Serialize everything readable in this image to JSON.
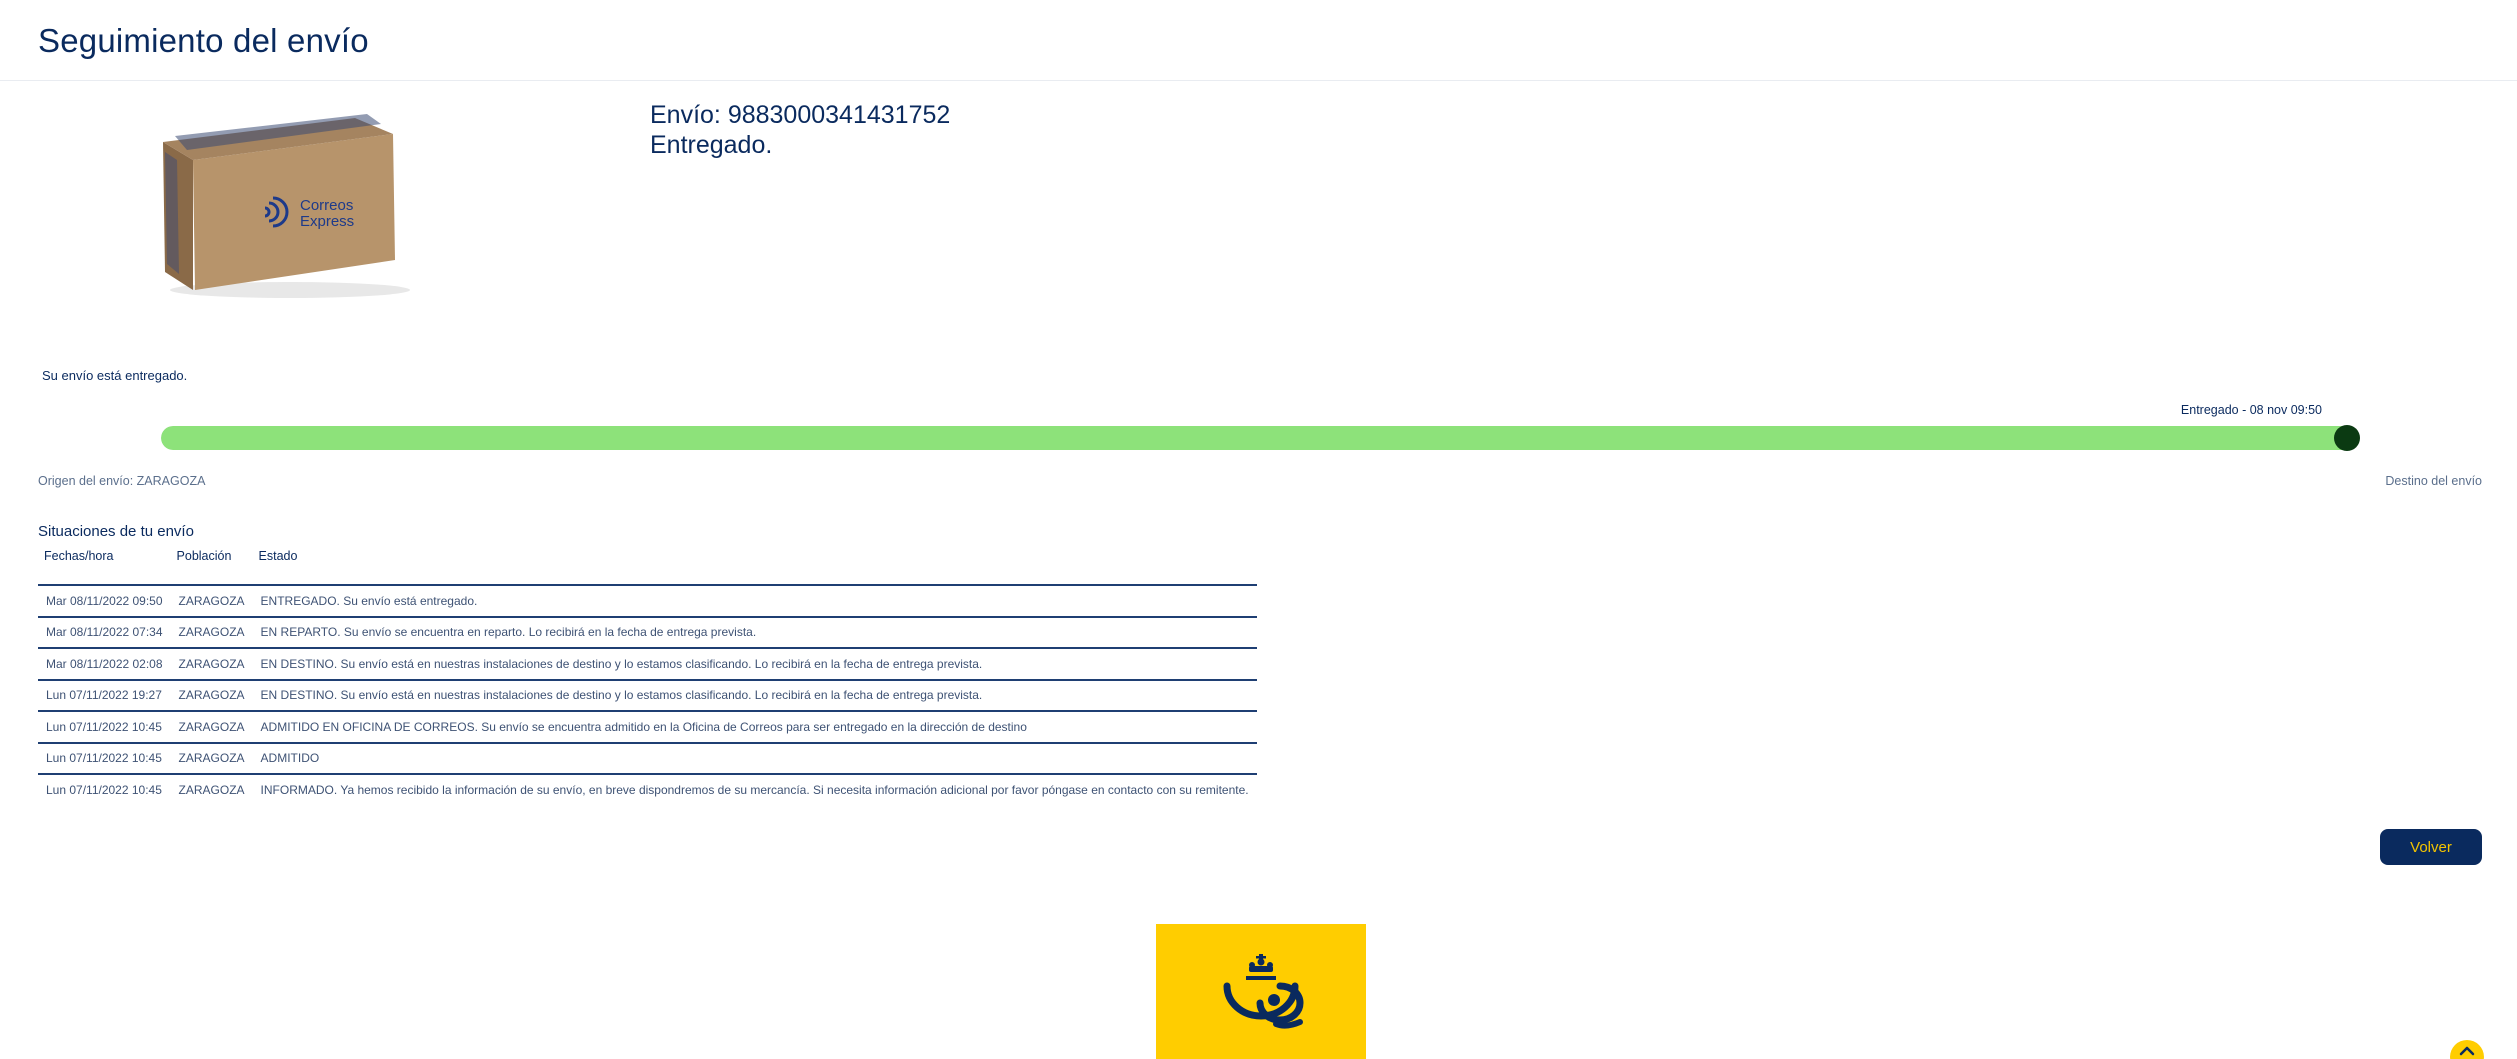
{
  "header": {
    "title": "Seguimiento del envío"
  },
  "shipment": {
    "number_label": "Envío: 9883000341431752",
    "state": "Entregado.",
    "box_brand": "Correos Express"
  },
  "progress": {
    "status_message": "Su envío está entregado.",
    "latest_event": "Entregado - 08 nov 09:50",
    "fraction": 1.0,
    "fill_color": "#8de27a",
    "dot_color": "#0b3a12",
    "origin": "Origen del envío: ZARAGOZA",
    "destination": "Destino del envío"
  },
  "events": {
    "title": "Situaciones de tu envío",
    "columns": [
      "Fechas/hora",
      "Población",
      "Estado"
    ],
    "rows": [
      {
        "date": "Mar 08/11/2022 09:50",
        "city": "ZARAGOZA",
        "status": "ENTREGADO. Su envío está entregado."
      },
      {
        "date": "Mar 08/11/2022 07:34",
        "city": "ZARAGOZA",
        "status": "EN REPARTO. Su envío se encuentra en reparto. Lo recibirá en la fecha de entrega prevista."
      },
      {
        "date": "Mar 08/11/2022 02:08",
        "city": "ZARAGOZA",
        "status": "EN DESTINO. Su envío está en nuestras instalaciones de destino y lo estamos clasificando. Lo recibirá en la fecha de entrega prevista."
      },
      {
        "date": "Lun 07/11/2022 19:27",
        "city": "ZARAGOZA",
        "status": "EN DESTINO. Su envío está en nuestras instalaciones de destino y lo estamos clasificando. Lo recibirá en la fecha de entrega prevista."
      },
      {
        "date": "Lun 07/11/2022 10:45",
        "city": "ZARAGOZA",
        "status": "ADMITIDO EN OFICINA DE CORREOS. Su envío se encuentra admitido en la Oficina de Correos para ser entregado en la dirección de destino"
      },
      {
        "date": "Lun 07/11/2022 10:45",
        "city": "ZARAGOZA",
        "status": "ADMITIDO"
      },
      {
        "date": "Lun 07/11/2022 10:45",
        "city": "ZARAGOZA",
        "status": "INFORMADO. Ya hemos recibido la información de su envío, en breve dispondremos de su mercancía. Si necesita información adicional por favor póngase en contacto con su remitente."
      }
    ]
  },
  "actions": {
    "back_label": "Volver"
  },
  "colors": {
    "brand_blue": "#0a2a5e",
    "brand_yellow": "#ffcd00"
  },
  "icons": {
    "footer_logo": "correos-posthorn-crown-icon",
    "scroll_top": "chevron-up-icon"
  }
}
